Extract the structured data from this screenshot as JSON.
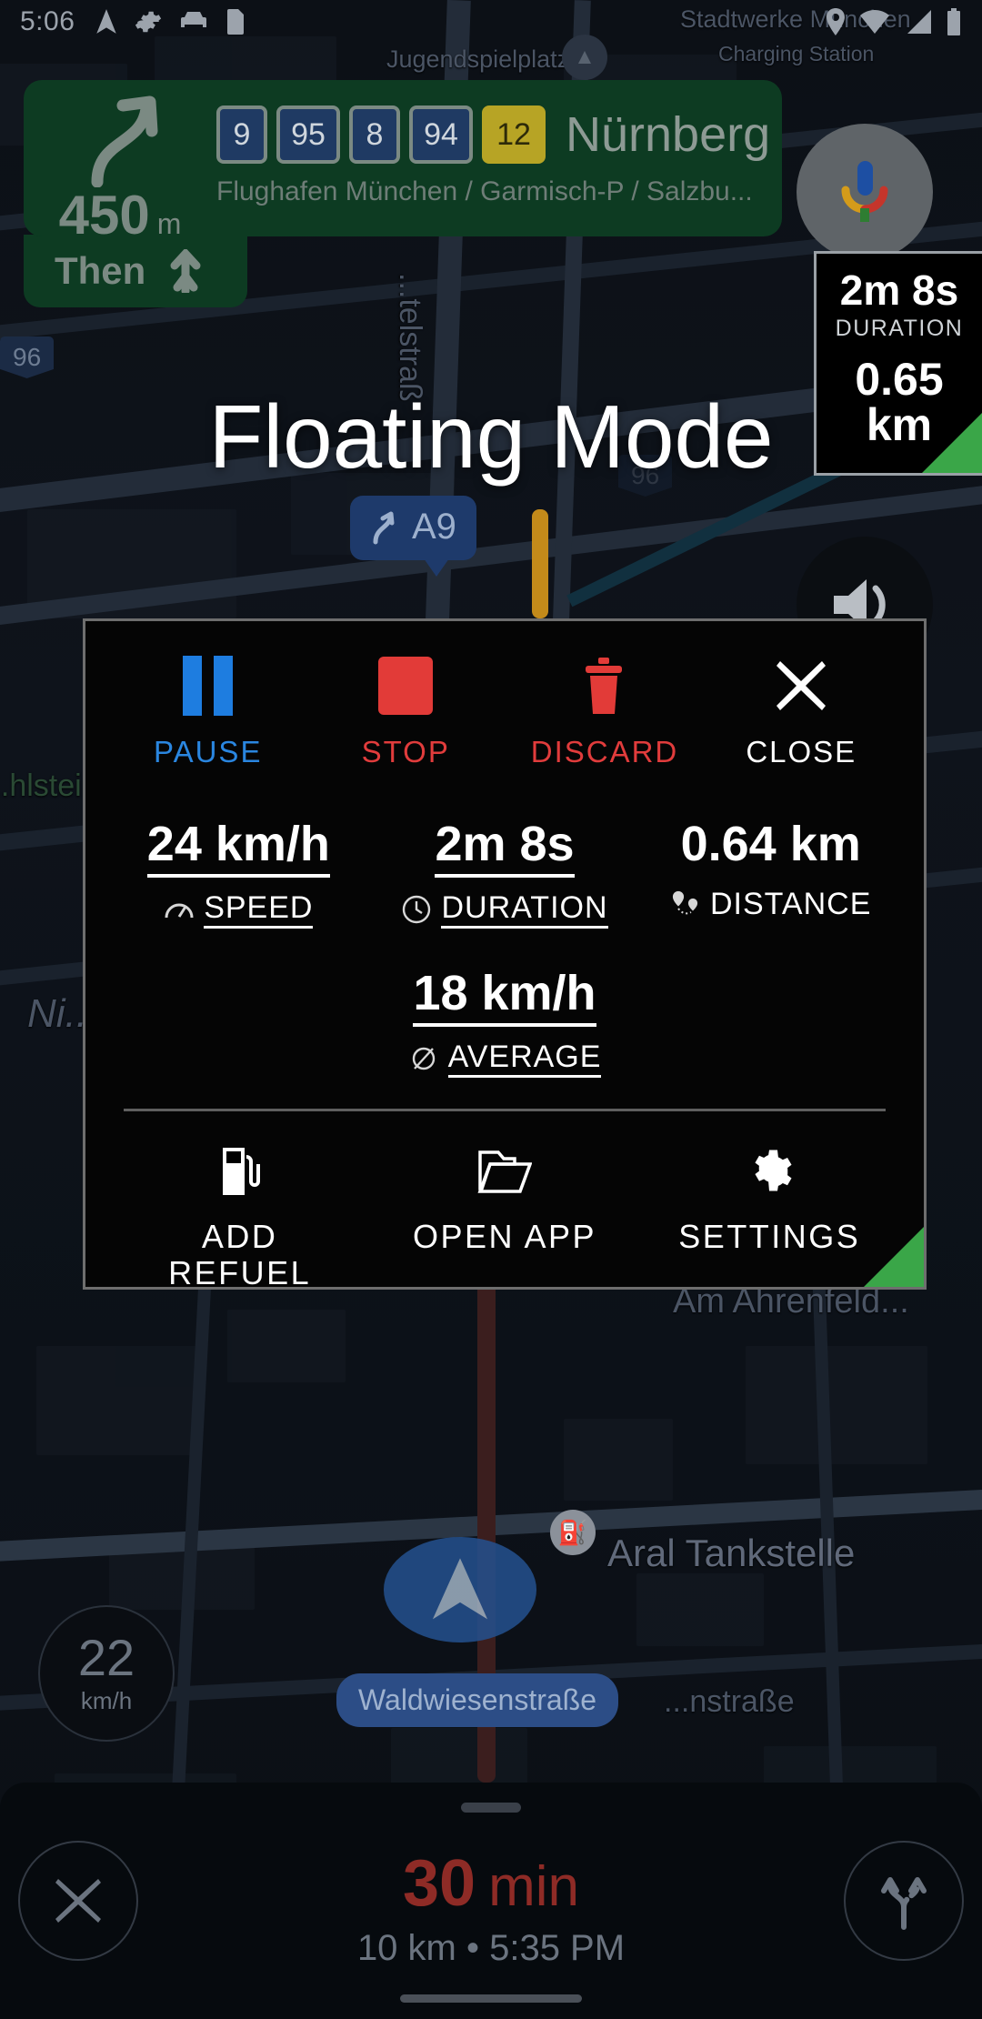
{
  "status_bar": {
    "time": "5:06",
    "left_icons": [
      "navigation-arrow-icon",
      "gear-icon",
      "car-icon",
      "sd-card-icon"
    ],
    "right_icons": [
      "location-pin-icon",
      "wifi-icon",
      "signal-icon",
      "battery-icon"
    ]
  },
  "nav_banner": {
    "turn_icon": "turn-right-merge-icon",
    "distance_value": "450",
    "distance_unit": "m",
    "shields": [
      {
        "label": "9",
        "style": "blue"
      },
      {
        "label": "95",
        "style": "blue"
      },
      {
        "label": "8",
        "style": "blue"
      },
      {
        "label": "94",
        "style": "blue"
      },
      {
        "label": "12",
        "style": "yellow"
      }
    ],
    "destination": "Nürnberg",
    "sub_destination": "Flughafen München / Garmisch-P / Salzbu...",
    "then_label": "Then",
    "then_icon": "continue-straight-icon"
  },
  "overlay_title": "Floating Mode",
  "mic_button": {
    "icon": "assistant-mic-icon"
  },
  "speaker_button": {
    "icon": "volume-on-icon"
  },
  "trip_widget": {
    "duration_value": "2m 8s",
    "duration_label": "DURATION",
    "distance_value": "0.65 km"
  },
  "dialog": {
    "top_actions": [
      {
        "label": "PAUSE",
        "icon": "pause-icon",
        "color": "#2a86e0"
      },
      {
        "label": "STOP",
        "icon": "stop-icon",
        "color": "#e13c3c"
      },
      {
        "label": "DISCARD",
        "icon": "trash-icon",
        "color": "#e13c3c"
      },
      {
        "label": "CLOSE",
        "icon": "close-icon",
        "color": "#ffffff"
      }
    ],
    "stats": [
      {
        "value": "24 km/h",
        "label": "SPEED",
        "icon": "speedometer-icon"
      },
      {
        "value": "2m 8s",
        "label": "DURATION",
        "icon": "clock-icon"
      },
      {
        "value": "0.64 km",
        "label": "DISTANCE",
        "icon": "route-pins-icon"
      }
    ],
    "average": {
      "value": "18 km/h",
      "label": "AVERAGE",
      "icon": "diameter-icon"
    },
    "bottom_actions": [
      {
        "label": "ADD REFUEL",
        "icon": "fuel-pump-icon"
      },
      {
        "label": "OPEN APP",
        "icon": "folder-icon"
      },
      {
        "label": "SETTINGS",
        "icon": "gear-icon"
      }
    ],
    "accent_color": "#3aa648"
  },
  "speed_badge": {
    "value": "22",
    "unit": "km/h"
  },
  "bottom_sheet": {
    "close_icon": "close-icon",
    "routes_icon": "alternate-routes-icon",
    "eta_number": "30",
    "eta_unit": "min",
    "eta_sub": "10 km  •  5:35 PM"
  },
  "map_labels": {
    "jugendspielplatz": "Jugendspielplatz",
    "stadtwerke": "Stadtwerke München",
    "charging_station": "Charging Station",
    "hlstein": "...hlstein",
    "ni": "Ni...",
    "am_ahrenfeld": "Am Ahrenfeld...",
    "aral": "Aral Tankstelle",
    "waldwiesenstrasse": "Waldwiesenstraße",
    "nstr": "...nstraße",
    "telstrass": "...telstraß",
    "shield_96": "96",
    "shield_96b": "96",
    "a9_bubble": "A9"
  }
}
